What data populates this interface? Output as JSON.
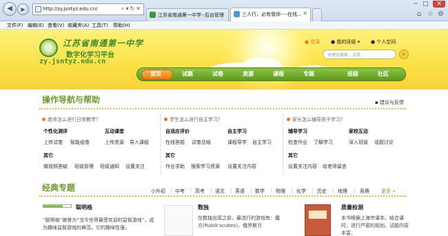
{
  "browser": {
    "url": "http://zy.jsntyz.edu.cn/",
    "tabs": [
      {
        "title": "江苏省南通第一中学--后台管理"
      },
      {
        "title": "三人行，必有我师----在线..."
      }
    ],
    "menu": [
      "文件(F)",
      "编辑(E)",
      "查看(V)",
      "收藏夹(A)",
      "工具(T)",
      "帮助(H)"
    ],
    "window_controls": {
      "minimize": "─",
      "maximize": "□",
      "close": "✕"
    }
  },
  "header": {
    "school_name": "江苏省南通第一中学",
    "platform_name": "数字化学习平台",
    "domain": "zy.jsntyz.edu.cn",
    "login": "登录",
    "my_class": "我的班级",
    "personal_space": "个人空间",
    "search_placeholder": "关键词搜索，试卷..."
  },
  "nav": {
    "items": [
      "首页",
      "试题",
      "试卷",
      "资源",
      "课程",
      "专题",
      "班级",
      "社区"
    ],
    "active": "首页"
  },
  "help": {
    "title": "操作导航与帮助",
    "feedback": "建议与反馈",
    "columns": [
      {
        "question": "老师怎么进行日常教学？",
        "groups": [
          {
            "title": "个性化测评",
            "links": [
              "上传试卷",
              "智能组卷"
            ]
          },
          {
            "title": "互动课堂",
            "links": [
              "上传资源",
              "导入课程"
            ]
          },
          {
            "title": "其它",
            "links": [
              "微视频答疑",
              "班级管理",
              "班级通知",
              "设置关注"
            ]
          }
        ]
      },
      {
        "question": "学生怎么进行自主学习？",
        "groups": [
          {
            "title": "自适应评价",
            "links": [
              "在线答题",
              "试卷总结"
            ]
          },
          {
            "title": "自主学习",
            "links": [
              "课程导学",
              "自主学习"
            ]
          },
          {
            "title": "其它",
            "links": [
              "作业求助",
              "搜索学习资源",
              "设置关注内容"
            ]
          }
        ]
      },
      {
        "question": "家长怎么辅导孩子学习？",
        "groups": [
          {
            "title": "辅导学习",
            "links": [
              "检查作业",
              "了解学习"
            ]
          },
          {
            "title": "家校互动",
            "links": [
              "深入班级",
              "话题讨论"
            ]
          },
          {
            "title": "其它",
            "links": [
              "设置关注内容",
              "给老师留言"
            ]
          }
        ]
      }
    ]
  },
  "topics": {
    "title": "经典专题",
    "tabs": [
      "小升初",
      "中考",
      "高考",
      "语文",
      "英语",
      "数学",
      "物理",
      "化学",
      "历史",
      "地理",
      "竞赛"
    ],
    "more": "更多 »",
    "cards": [
      {
        "title": "聪明格",
        "text": "“聪明格”被誉为“当今世界最受欢迎的益智游戏”，成为趣味益智游戏的典范。它的趣味性强，"
      },
      {
        "title": "数独",
        "text": "在数独出现之前，最流行的游戏有：魔方(Rubik'scubes)、俄罗斯方"
      },
      {
        "title": "质量检测",
        "text": "本书根据上海市课本，结合课时，进行严密的规划。试题内容丰富，"
      }
    ]
  },
  "colors": {
    "brand_green": "#3c8a2c",
    "nav_green": "#6aa82b",
    "nav_active": "#f08a1c",
    "banner_yellow": "#fbe147"
  }
}
